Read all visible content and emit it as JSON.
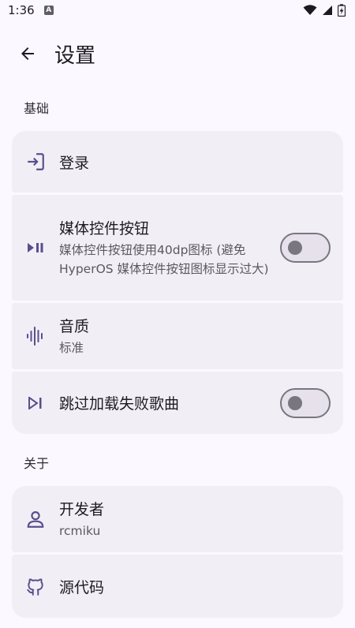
{
  "status_bar": {
    "time": "1:36",
    "badge": "A"
  },
  "header": {
    "title": "设置"
  },
  "sections": {
    "basic": {
      "label": "基础",
      "items": [
        {
          "title": "登录",
          "icon": "login-icon"
        },
        {
          "title": "媒体控件按钮",
          "subtitle": "媒体控件按钮使用40dp图标 (避免 HyperOS 媒体控件按钮图标显示过大)",
          "icon": "play-pause-icon",
          "switch_on": false
        },
        {
          "title": "音质",
          "subtitle": "标准",
          "icon": "sound-wave-icon"
        },
        {
          "title": "跳过加载失败歌曲",
          "icon": "skip-next-icon",
          "switch_on": false
        }
      ]
    },
    "about": {
      "label": "关于",
      "items": [
        {
          "title": "开发者",
          "subtitle": "rcmiku",
          "icon": "person-icon"
        },
        {
          "title": "源代码",
          "icon": "github-icon"
        }
      ]
    }
  },
  "colors": {
    "background": "#FCF8FF",
    "card": "#F2EEF6",
    "accent": "#5B4E8C"
  }
}
